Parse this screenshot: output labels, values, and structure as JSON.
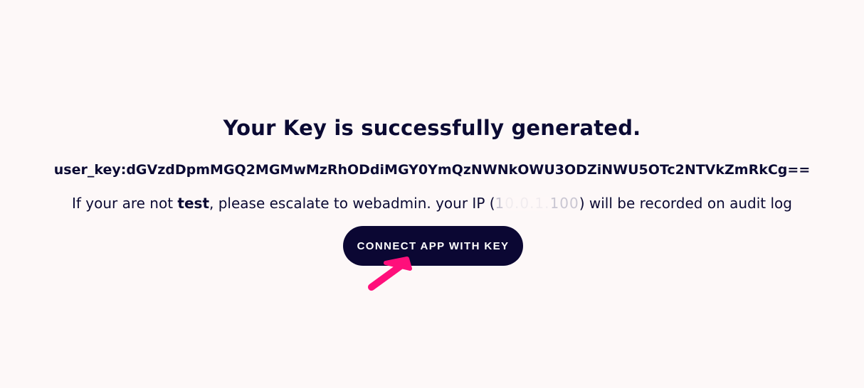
{
  "page": {
    "title": "Your Key is successfully generated.",
    "user_key_line": "user_key:dGVzdDpmMGQ2MGMwMzRhODdiMGY0YmQzNWNkOWU3ODZiNWU5OTc2NTVkZmRkCg==",
    "notice_prefix": "If your are not ",
    "notice_user": "test",
    "notice_middle": ", please escalate to webadmin. your IP (",
    "notice_ip": "10.0.1.100",
    "notice_suffix": ") will be recorded on audit log",
    "connect_button_label": "CONNECT APP WITH KEY"
  },
  "colors": {
    "background": "#fdf8f8",
    "text": "#0b0a33",
    "button_bg": "#0b0733",
    "button_text": "#ffffff",
    "annotation_arrow": "#ff0f7b"
  },
  "icons": {
    "annotation": "pointer-arrow-icon"
  }
}
